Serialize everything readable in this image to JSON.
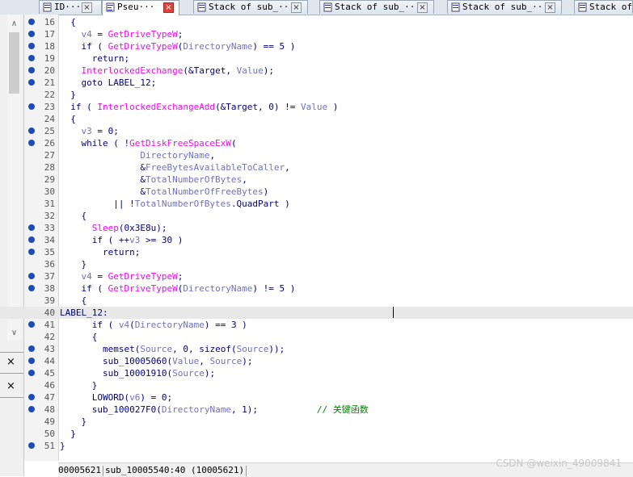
{
  "tabs": [
    {
      "label": "ID···",
      "close": "×"
    },
    {
      "label": "Pseu···",
      "close": "×"
    },
    {
      "label": "Stack of sub_···",
      "close": "×"
    },
    {
      "label": "Stack of sub_···",
      "close": "×"
    },
    {
      "label": "Stack of sub_···",
      "close": "×"
    },
    {
      "label": "Stack of",
      "close": ""
    }
  ],
  "left_panel": {
    "scroll_up": "∧",
    "scroll_down": "∨",
    "close_1": "×",
    "close_2": "×"
  },
  "code_lines": [
    {
      "n": "16",
      "dot": true,
      "html": "  {"
    },
    {
      "n": "17",
      "dot": true,
      "html": "    <span class=\"v\">v4</span> = <span class=\"fn\">GetDriveTypeW</span>;"
    },
    {
      "n": "18",
      "dot": true,
      "html": "    if ( <span class=\"fn\">GetDriveTypeW</span>(<span class=\"v\">DirectoryName</span>) == 5 )"
    },
    {
      "n": "19",
      "dot": true,
      "html": "      return;"
    },
    {
      "n": "20",
      "dot": true,
      "html": "    <span class=\"fn\">InterlockedExchange</span>(&amp;Target, <span class=\"v\">Value</span>);"
    },
    {
      "n": "21",
      "dot": true,
      "html": "    goto LABEL_12;"
    },
    {
      "n": "22",
      "dot": false,
      "html": "  }"
    },
    {
      "n": "23",
      "dot": true,
      "html": "  if ( <span class=\"fn\">InterlockedExchangeAdd</span>(&amp;Target, 0) != <span class=\"v\">Value</span> )"
    },
    {
      "n": "24",
      "dot": false,
      "html": "  {"
    },
    {
      "n": "25",
      "dot": true,
      "html": "    <span class=\"v\">v3</span> = 0;"
    },
    {
      "n": "26",
      "dot": true,
      "html": "    while ( !<span class=\"fn\">GetDiskFreeSpaceExW</span>("
    },
    {
      "n": "27",
      "dot": false,
      "html": "               <span class=\"v\">DirectoryName</span>,"
    },
    {
      "n": "28",
      "dot": false,
      "html": "               &amp;<span class=\"v\">FreeBytesAvailableToCaller</span>,"
    },
    {
      "n": "29",
      "dot": false,
      "html": "               &amp;<span class=\"v\">TotalNumberOfBytes</span>,"
    },
    {
      "n": "30",
      "dot": false,
      "html": "               &amp;<span class=\"v\">TotalNumberOfFreeBytes</span>)"
    },
    {
      "n": "31",
      "dot": false,
      "html": "          || !<span class=\"v\">TotalNumberOfBytes</span>.QuadPart )"
    },
    {
      "n": "32",
      "dot": false,
      "html": "    {"
    },
    {
      "n": "33",
      "dot": true,
      "html": "      <span class=\"fn\">Sleep</span>(0x3E8u);"
    },
    {
      "n": "34",
      "dot": true,
      "html": "      if ( ++<span class=\"v\">v3</span> >= 30 )"
    },
    {
      "n": "35",
      "dot": true,
      "html": "        return;"
    },
    {
      "n": "36",
      "dot": false,
      "html": "    }"
    },
    {
      "n": "37",
      "dot": true,
      "html": "    <span class=\"v\">v4</span> = <span class=\"fn\">GetDriveTypeW</span>;"
    },
    {
      "n": "38",
      "dot": true,
      "html": "    if ( <span class=\"fn\">GetDriveTypeW</span>(<span class=\"v\">DirectoryName</span>) != 5 )"
    },
    {
      "n": "39",
      "dot": false,
      "html": "    {"
    },
    {
      "n": "40",
      "dot": false,
      "html": "LABEL_12:",
      "highlight": true
    },
    {
      "n": "41",
      "dot": true,
      "html": "      if ( <span class=\"v\">v4</span>(<span class=\"v\">DirectoryName</span>) == 3 )"
    },
    {
      "n": "42",
      "dot": false,
      "html": "      {"
    },
    {
      "n": "43",
      "dot": true,
      "html": "        memset(<span class=\"v\">Source</span>, 0, sizeof(<span class=\"v\">Source</span>));"
    },
    {
      "n": "44",
      "dot": true,
      "html": "        sub_10005060(<span class=\"v\">Value</span>, <span class=\"v\">Source</span>);"
    },
    {
      "n": "45",
      "dot": true,
      "html": "        sub_10001910(<span class=\"v\">Source</span>);"
    },
    {
      "n": "46",
      "dot": false,
      "html": "      }"
    },
    {
      "n": "47",
      "dot": true,
      "html": "      LOWORD(<span class=\"v\">v6</span>) = 0;"
    },
    {
      "n": "48",
      "dot": true,
      "html": "      sub_100027F0(<span class=\"v\">DirectoryName</span>, 1);           <span class=\"cm\">// 关键函数</span>"
    },
    {
      "n": "49",
      "dot": false,
      "html": "    }"
    },
    {
      "n": "50",
      "dot": false,
      "html": "  }"
    },
    {
      "n": "51",
      "dot": true,
      "html": "}"
    }
  ],
  "status": {
    "address": "00005621",
    "location": "sub_10005540:40 (10005621)"
  },
  "watermark": "CSDN @weixin_49009841",
  "colors": {
    "keyword": "#000080",
    "function": "#ff00ff",
    "variable": "#7070c0",
    "comment": "#008000",
    "breakpoint_dot": "#1f4bb8"
  }
}
